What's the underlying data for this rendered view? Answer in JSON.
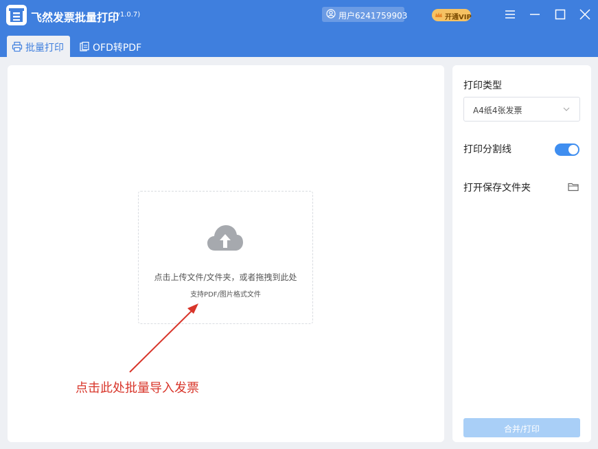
{
  "app": {
    "title": "飞然发票批量打印",
    "version": "(v1.0.7)"
  },
  "header": {
    "user_label": "用户6241759903",
    "vip_label": "开通VIP"
  },
  "tabs": [
    {
      "label": "批量打印",
      "icon": "printer-icon",
      "active": true
    },
    {
      "label": "OFD转PDF",
      "icon": "document-convert-icon",
      "active": false
    }
  ],
  "upload": {
    "main_text": "点击上传文件/文件夹，或者拖拽到此处",
    "sub_text": "支持PDF/图片格式文件"
  },
  "annotation": {
    "text": "点击此处批量导入发票",
    "color": "#d8352a"
  },
  "settings": {
    "print_type_label": "打印类型",
    "print_type_value": "A4纸4张发票",
    "divider_label": "打印分割线",
    "divider_on": true,
    "open_folder_label": "打开保存文件夹",
    "merge_print_label": "合并/打印"
  },
  "colors": {
    "brand": "#3f7fde",
    "toggle_on": "#3f8ef0",
    "disabled_button": "#a9cff7",
    "vip": "#f6c263"
  }
}
